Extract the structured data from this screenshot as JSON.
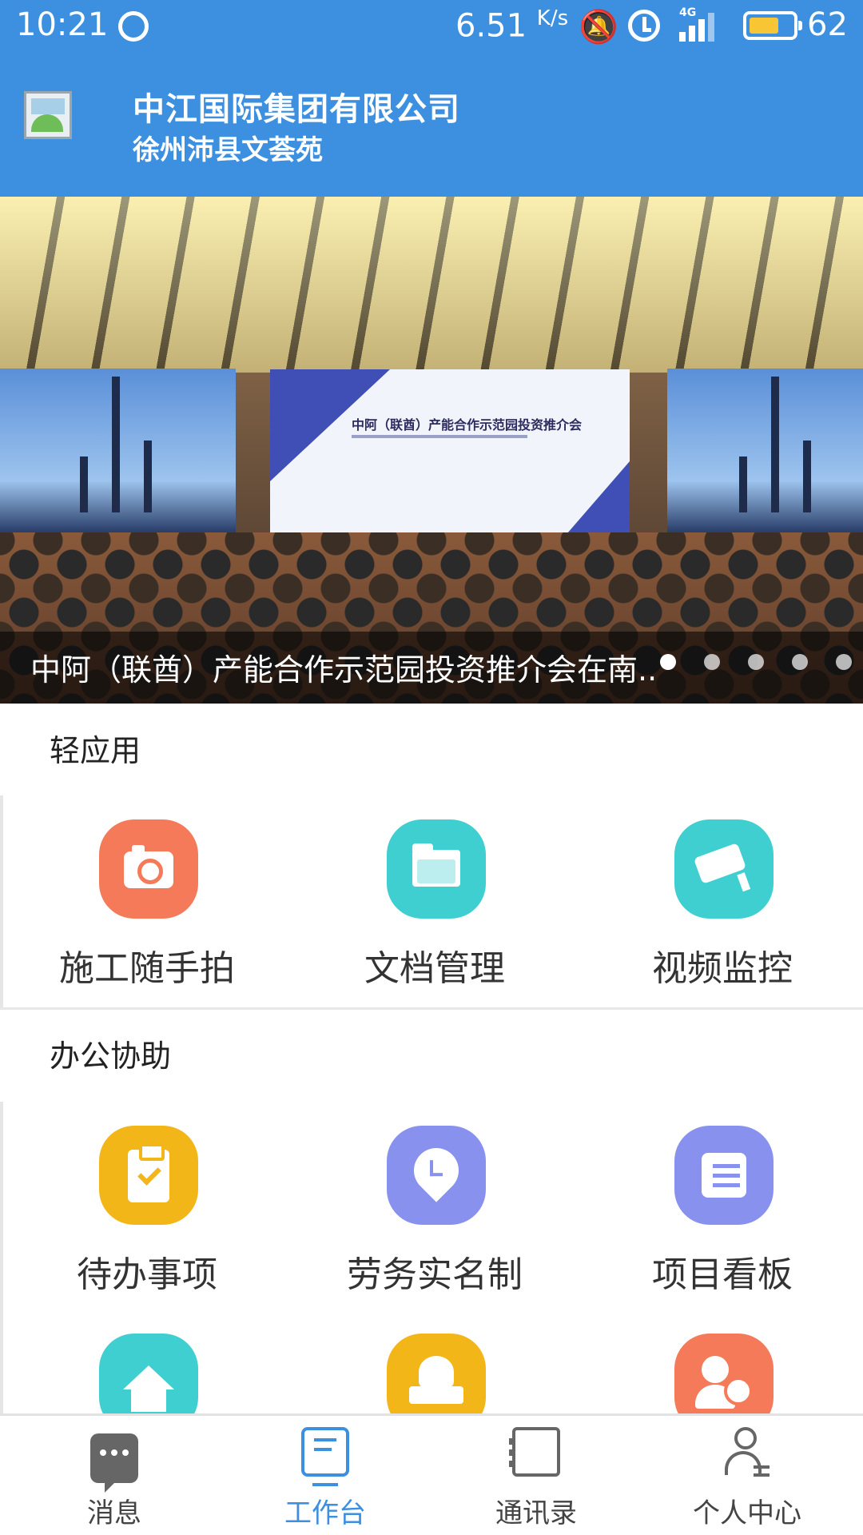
{
  "status_bar": {
    "time": "10:21",
    "network_speed": "6.51",
    "network_speed_unit": "K/s",
    "network_type": "4G",
    "battery": "62"
  },
  "header": {
    "company": "中江国际集团有限公司",
    "project": "徐州沛县文荟苑"
  },
  "banner": {
    "caption": "中阿（联酋）产能合作示范园投资推介会在南..",
    "screen_title": "中阿（联酋）产能合作示范园投资推介会",
    "slide_count": 5,
    "active_slide": 1
  },
  "sections": [
    {
      "title": "轻应用",
      "apps": [
        {
          "label": "施工随手拍",
          "icon": "camera-icon",
          "color": "#f47a5a"
        },
        {
          "label": "文档管理",
          "icon": "folder-icon",
          "color": "#3fcfd1"
        },
        {
          "label": "视频监控",
          "icon": "cctv-icon",
          "color": "#3fcfd1"
        }
      ]
    },
    {
      "title": "办公协助",
      "apps": [
        {
          "label": "待办事项",
          "icon": "clipboard-icon",
          "color": "#f2b619"
        },
        {
          "label": "劳务实名制",
          "icon": "location-time-icon",
          "color": "#8892ee"
        },
        {
          "label": "项目看板",
          "icon": "list-icon",
          "color": "#8892ee"
        },
        {
          "label": "",
          "icon": "house-icon",
          "color": "#3fcfd1"
        },
        {
          "label": "",
          "icon": "stamp-icon",
          "color": "#f2b619"
        },
        {
          "label": "",
          "icon": "person-clock-icon",
          "color": "#f47a5a"
        }
      ]
    }
  ],
  "bottom_nav": [
    {
      "label": "消息",
      "icon": "message-icon",
      "active": false
    },
    {
      "label": "工作台",
      "icon": "desk-icon",
      "active": true
    },
    {
      "label": "通讯录",
      "icon": "contacts-book-icon",
      "active": false
    },
    {
      "label": "个人中心",
      "icon": "user-icon",
      "active": false
    }
  ],
  "colors": {
    "primary": "#3d8fe0",
    "orange": "#f47a5a",
    "teal": "#3fcfd1",
    "yellow": "#f2b619",
    "purple": "#8892ee"
  }
}
